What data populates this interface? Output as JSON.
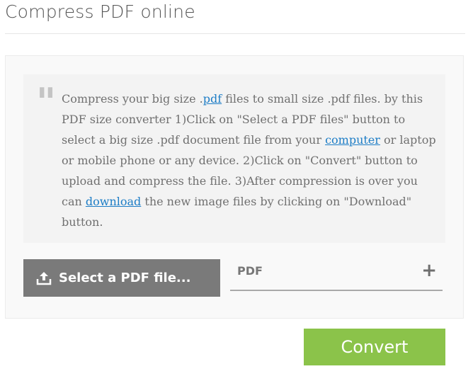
{
  "page": {
    "title": "Compress PDF online"
  },
  "description": {
    "quote_icon": "quote-mark-icon",
    "parts": {
      "t1": "Compress your big size .",
      "link1": "pdf",
      "t2": " files to small size .pdf files. by this PDF size converter 1)Click on \"Select a PDF files\" button to select a big size .pdf document file from your ",
      "link2": "computer",
      "t3": " or laptop or mobile phone or any device. 2)Click on \"Convert\" button to upload and compress the file. 3)After compression is over you can ",
      "link3": "download",
      "t4": " the new image files by clicking on \"Download\" button."
    }
  },
  "uploader": {
    "select_label": "Select a PDF file...",
    "select_icon": "upload-icon",
    "field_label": "PDF",
    "add_icon": "plus-icon"
  },
  "actions": {
    "convert_label": "Convert"
  },
  "colors": {
    "convert_bg": "#8bc34a",
    "select_bg": "#7a7a7a",
    "link": "#1d7dc6"
  }
}
